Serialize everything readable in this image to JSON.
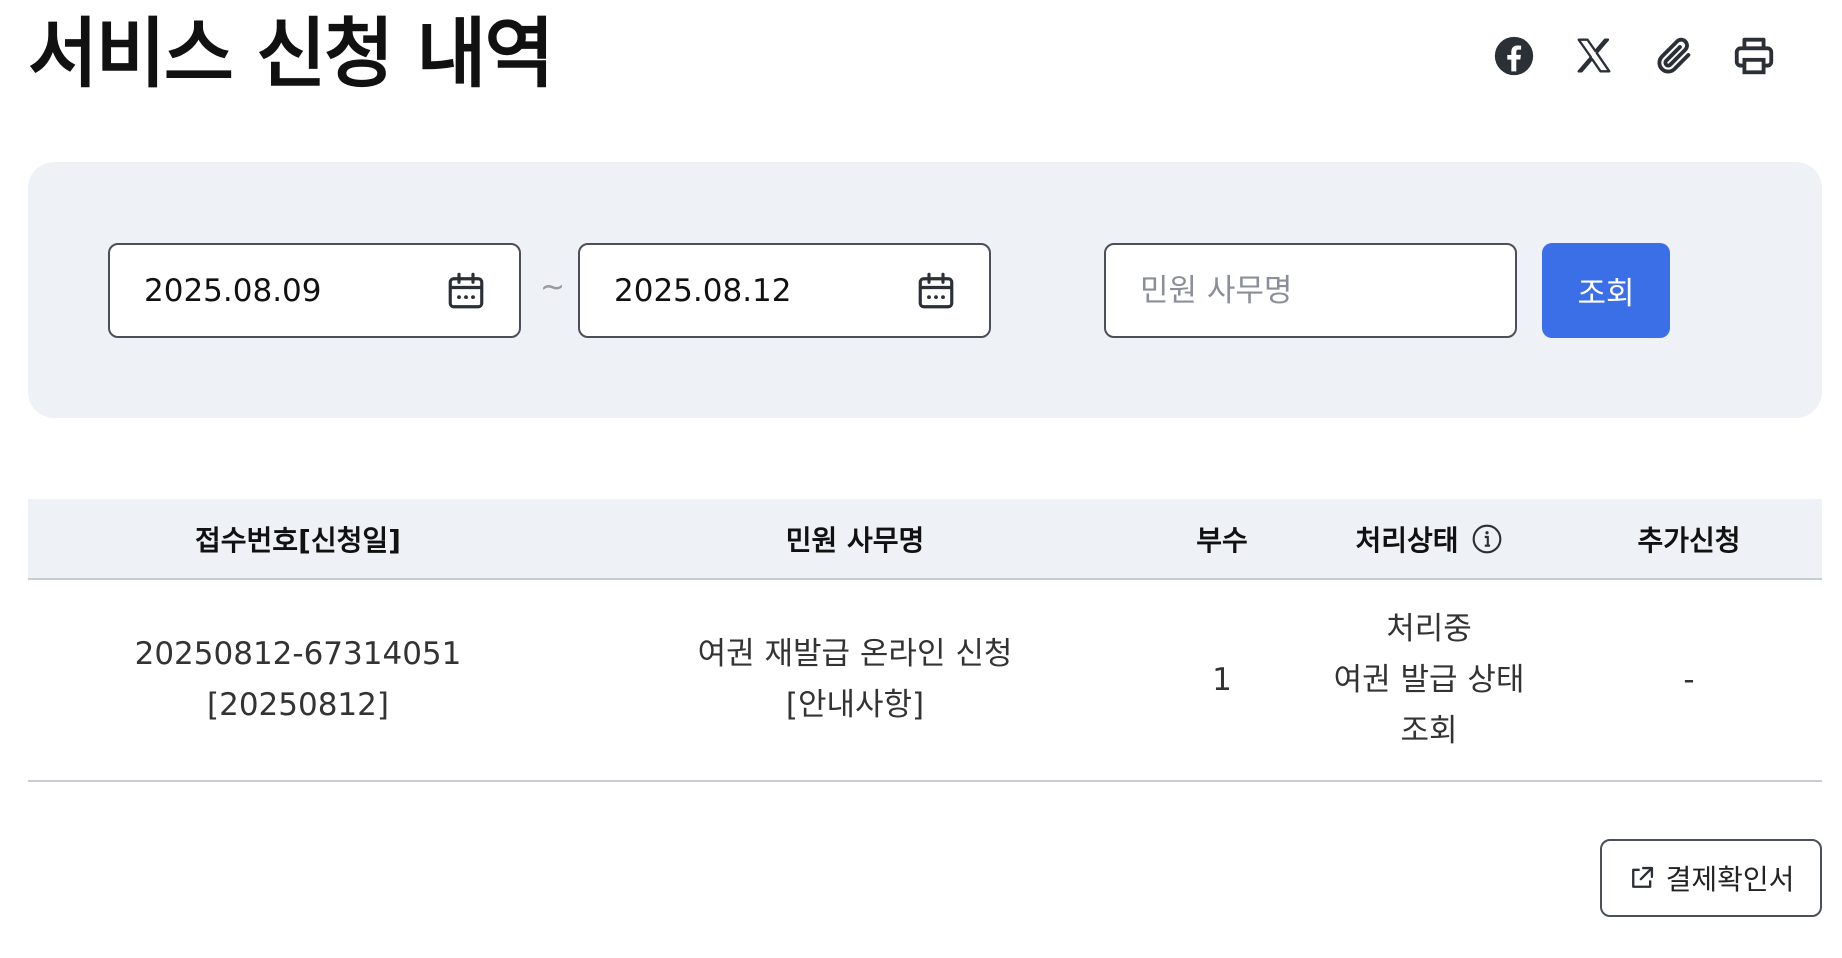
{
  "page": {
    "title": "서비스 신청 내역"
  },
  "share": {
    "icons": [
      "facebook-icon",
      "x-icon",
      "paperclip-icon",
      "printer-icon"
    ]
  },
  "search": {
    "start_date": "2025.08.09",
    "end_date": "2025.08.12",
    "separator": "~",
    "name_placeholder": "민원 사무명",
    "name_value": "",
    "button_label": "조회"
  },
  "table": {
    "headers": {
      "receipt_no": "접수번호[신청일]",
      "service_name": "민원 사무명",
      "copies": "부수",
      "status": "처리상태",
      "additional": "추가신청"
    },
    "rows": [
      {
        "receipt_no": "20250812-67314051",
        "apply_date": "[20250812]",
        "service_name": "여권 재발급 온라인 신청",
        "notice_link": "[안내사항]",
        "copies": "1",
        "status": "처리중",
        "status_link_line1": "여권 발급 상태",
        "status_link_line2": "조회",
        "additional": "-"
      }
    ]
  },
  "actions": {
    "receipt_button_label": "결제확인서"
  },
  "colors": {
    "accent": "#3b6fe8",
    "panel_bg": "#eef2f7",
    "border": "#4a4f59"
  }
}
